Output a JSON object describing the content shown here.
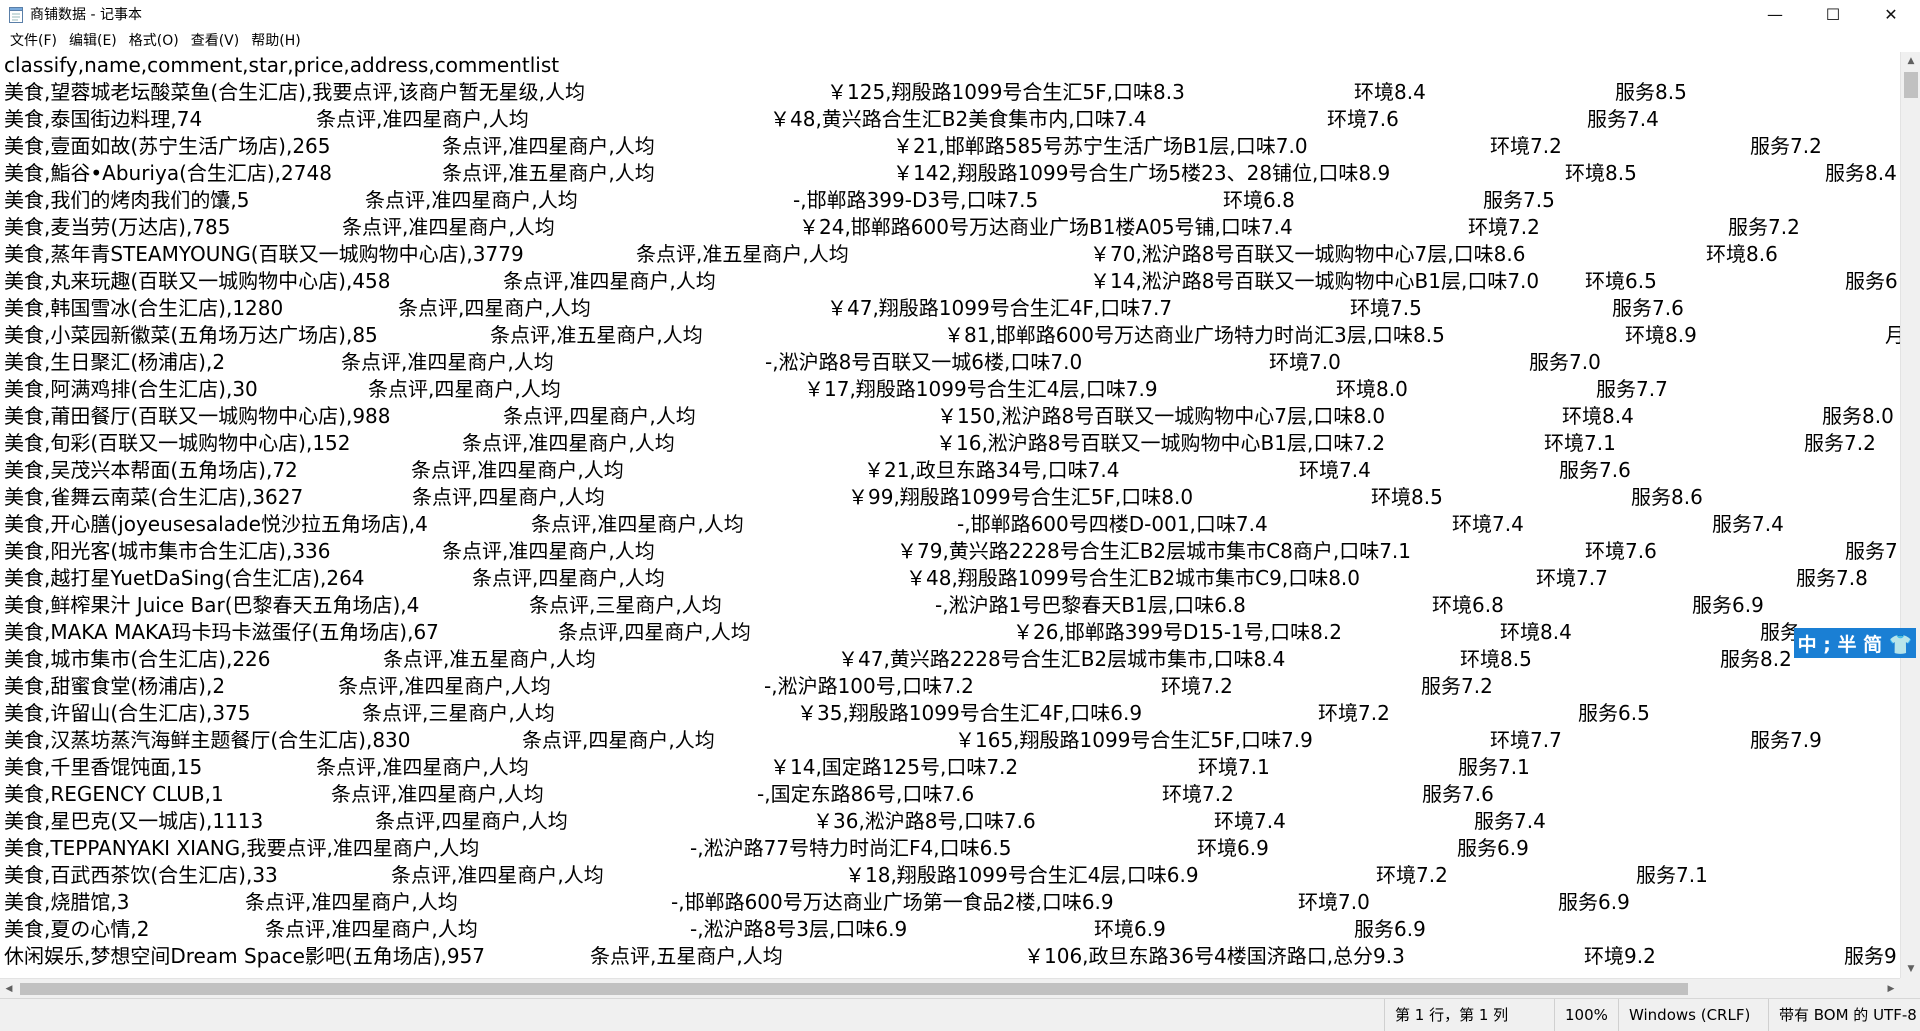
{
  "window": {
    "title": "商铺数据 - 记事本",
    "icon": "notepad-icon",
    "controls": {
      "minimize": "—",
      "maximize": "☐",
      "close": "✕"
    }
  },
  "menu": [
    "文件(F)",
    "编辑(E)",
    "格式(O)",
    "查看(V)",
    "帮助(H)"
  ],
  "header_line": "classify,name,comment,star,price,address,commentlist",
  "rows": [
    [
      "美食,望蓉城老坛酸菜鱼(合生汇店),我要点评,该商户暂无星级,人均",
      "￥125,翔殷路1099号合生汇5F,口味8.3",
      "环境8.4",
      "服务8.5"
    ],
    [
      "美食,泰国街边料理,74",
      "条点评,准四星商户,人均",
      "￥48,黄兴路合生汇B2美食集市内,口味7.4",
      "环境7.6",
      "服务7.4"
    ],
    [
      "美食,壹面如故(苏宁生活广场店),265",
      "条点评,准四星商户,人均",
      "￥21,邯郸路585号苏宁生活广场B1层,口味7.0",
      "环境7.2",
      "服务7.2"
    ],
    [
      "美食,鮨谷•Aburiya(合生汇店),2748",
      "条点评,准五星商户,人均",
      "￥142,翔殷路1099号合生广场5楼23、28铺位,口味8.9",
      "环境8.5",
      "服务8.4"
    ],
    [
      "美食,我们的烤肉我们的馕,5",
      "条点评,准四星商户,人均",
      "-,邯郸路399-D3号,口味7.5",
      "环境6.8",
      "服务7.5"
    ],
    [
      "美食,麦当劳(万达店),785",
      "条点评,准四星商户,人均",
      "￥24,邯郸路600号万达商业广场B1楼A05号铺,口味7.4",
      "环境7.2",
      "服务7.2"
    ],
    [
      "美食,蒸年青STEAMYOUNG(百联又一城购物中心店),3779",
      "条点评,准五星商户,人均",
      "￥70,淞沪路8号百联又一城购物中心7层,口味8.6",
      "环境8.6",
      ""
    ],
    [
      "美食,丸来玩趣(百联又一城购物中心店),458",
      "条点评,准四星商户,人均",
      "￥14,淞沪路8号百联又一城购物中心B1层,口味7.0",
      "环境6.5",
      "服务6"
    ],
    [
      "美食,韩国雪冰(合生汇店),1280",
      "条点评,四星商户,人均",
      "￥47,翔殷路1099号合生汇4F,口味7.7",
      "环境7.5",
      "服务7.6"
    ],
    [
      "美食,小菜园新徽菜(五角场万达广场店),85",
      "条点评,准五星商户,人均",
      "￥81,邯郸路600号万达商业广场特力时尚汇3层,口味8.5",
      "环境8.9",
      "月"
    ],
    [
      "美食,生日聚汇(杨浦店),2",
      "条点评,准四星商户,人均",
      "-,淞沪路8号百联又一城6楼,口味7.0",
      "环境7.0",
      "服务7.0"
    ],
    [
      "美食,阿满鸡排(合生汇店),30",
      "条点评,四星商户,人均",
      "￥17,翔殷路1099号合生汇4层,口味7.9",
      "环境8.0",
      "服务7.7"
    ],
    [
      "美食,莆田餐厅(百联又一城购物中心店),988",
      "条点评,四星商户,人均",
      "￥150,淞沪路8号百联又一城购物中心7层,口味8.0",
      "环境8.4",
      "服务8.0"
    ],
    [
      "美食,旬彩(百联又一城购物中心店),152",
      "条点评,准四星商户,人均",
      "￥16,淞沪路8号百联又一城购物中心B1层,口味7.2",
      "环境7.1",
      "服务7.2"
    ],
    [
      "美食,吴茂兴本帮面(五角场店),72",
      "条点评,准四星商户,人均",
      "￥21,政旦东路34号,口味7.4",
      "环境7.4",
      "服务7.6"
    ],
    [
      "美食,雀舞云南菜(合生汇店),3627",
      "条点评,四星商户,人均",
      "￥99,翔殷路1099号合生汇5F,口味8.0",
      "环境8.5",
      "服务8.6"
    ],
    [
      "美食,开心膳(joyeusesalade悦沙拉五角场店),4",
      "条点评,准四星商户,人均",
      "-,邯郸路600号四楼D-001,口味7.4",
      "环境7.4",
      "服务7.4"
    ],
    [
      "美食,阳光客(城市集市合生汇店),336",
      "条点评,准四星商户,人均",
      "￥79,黄兴路2228号合生汇B2层城市集市C8商户,口味7.1",
      "环境7.6",
      "服务7"
    ],
    [
      "美食,越打星YuetDaSing(合生汇店),264",
      "条点评,四星商户,人均",
      "￥48,翔殷路1099号合生汇B2城市集市C9,口味8.0",
      "环境7.7",
      "服务7.8"
    ],
    [
      "美食,鲜榨果汁 Juice Bar(巴黎春天五角场店),4",
      "条点评,三星商户,人均",
      "-,淞沪路1号巴黎春天B1层,口味6.8",
      "环境6.8",
      "服务6.9"
    ],
    [
      "美食,MAKA MAKA玛卡玛卡滋蛋仔(五角场店),67",
      "条点评,四星商户,人均",
      "￥26,邯郸路399号D15-1号,口味8.2",
      "环境8.4",
      "服务"
    ],
    [
      "美食,城市集市(合生汇店),226",
      "条点评,准五星商户,人均",
      "￥47,黄兴路2228号合生汇B2层城市集市,口味8.4",
      "环境8.5",
      "服务8.2"
    ],
    [
      "美食,甜蜜食堂(杨浦店),2",
      "条点评,准四星商户,人均",
      "-,淞沪路100号,口味7.2",
      "环境7.2",
      "服务7.2"
    ],
    [
      "美食,许留山(合生汇店),375",
      "条点评,三星商户,人均",
      "￥35,翔殷路1099号合生汇4F,口味6.9",
      "环境7.2",
      "服务6.5"
    ],
    [
      "美食,汉蒸坊蒸汽海鲜主题餐厅(合生汇店),830",
      "条点评,四星商户,人均",
      "￥165,翔殷路1099号合生汇5F,口味7.9",
      "环境7.7",
      "服务7.9"
    ],
    [
      "美食,千里香馄饨面,15",
      "条点评,准四星商户,人均",
      "￥14,国定路125号,口味7.2",
      "环境7.1",
      "服务7.1"
    ],
    [
      "美食,REGENCY CLUB,1",
      "条点评,准四星商户,人均",
      "-,国定东路86号,口味7.6",
      "环境7.2",
      "服务7.6"
    ],
    [
      "美食,星巴克(又一城店),1113",
      "条点评,四星商户,人均",
      "￥36,淞沪路8号,口味7.6",
      "环境7.4",
      "服务7.4"
    ],
    [
      "美食,TEPPANYAKI XIANG,我要点评,准四星商户,人均",
      "-,淞沪路77号特力时尚汇F4,口味6.5",
      "环境6.9",
      "服务6.9"
    ],
    [
      "美食,百武西茶饮(合生汇店),33",
      "条点评,准四星商户,人均",
      "￥18,翔殷路1099号合生汇4层,口味6.9",
      "环境7.2",
      "服务7.1"
    ],
    [
      "美食,烧腊馆,3",
      "条点评,准四星商户,人均",
      "-,邯郸路600号万达商业广场第一食品2楼,口味6.9",
      "环境7.0",
      "服务6.9"
    ],
    [
      "美食,夏の心情,2",
      "条点评,准四星商户,人均",
      "-,淞沪路8号3层,口味6.9",
      "环境6.9",
      "服务6.9"
    ],
    [
      "休闲娱乐,梦想空间Dream Space影吧(五角场店),957",
      "条点评,五星商户,人均",
      "￥106,政旦东路36号4楼国济路口,总分9.3",
      "环境9.2",
      "服务9"
    ]
  ],
  "status": {
    "position": "第 1 行，第 1 列",
    "zoom": "100%",
    "line_ending": "Windows (CRLF)",
    "encoding": "带有 BOM 的 UTF-8"
  },
  "ime": "中 ; 半 简 👕",
  "colors": {
    "ime_bg": "#1a7fd4",
    "scroll_bg": "#f0f0f0",
    "scroll_thumb": "#c1c1c1"
  }
}
